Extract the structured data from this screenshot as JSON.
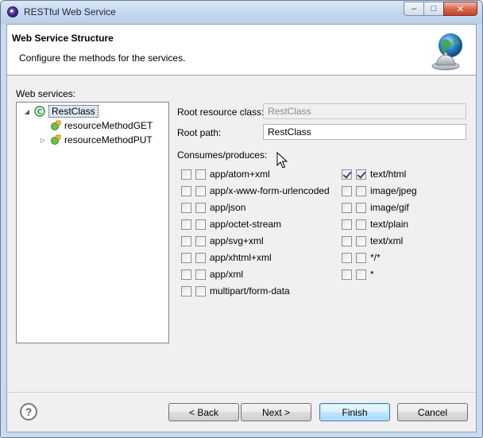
{
  "window": {
    "title": "RESTful Web Service",
    "minimize_glyph": "–",
    "maximize_glyph": "□",
    "close_glyph": "✕"
  },
  "banner": {
    "title": "Web Service Structure",
    "subtitle": "Configure the methods for the services.",
    "icon": "globe-bell-icon"
  },
  "web_services": {
    "label": "Web services:",
    "tree": [
      {
        "label": "RestClass",
        "level": 0,
        "expanded": true,
        "selected": true,
        "icon": "rest-class-icon"
      },
      {
        "label": "resourceMethodGET",
        "level": 1,
        "expanded": false,
        "has_children": false,
        "icon": "resource-method-icon"
      },
      {
        "label": "resourceMethodPUT",
        "level": 1,
        "expanded": false,
        "has_children": true,
        "icon": "resource-method-icon"
      }
    ]
  },
  "form": {
    "root_resource_class_label": "Root resource class:",
    "root_resource_class_value": "RestClass",
    "root_path_label": "Root path:",
    "root_path_value": "RestClass",
    "consumes_produces_label": "Consumes/produces:"
  },
  "media_types_left": [
    {
      "label": "app/atom+xml",
      "consumes": false,
      "produces": false
    },
    {
      "label": "app/x-www-form-urlencoded",
      "consumes": false,
      "produces": false
    },
    {
      "label": "app/json",
      "consumes": false,
      "produces": false
    },
    {
      "label": "app/octet-stream",
      "consumes": false,
      "produces": false
    },
    {
      "label": "app/svg+xml",
      "consumes": false,
      "produces": false
    },
    {
      "label": "app/xhtml+xml",
      "consumes": false,
      "produces": false
    },
    {
      "label": "app/xml",
      "consumes": false,
      "produces": false
    },
    {
      "label": "multipart/form-data",
      "consumes": false,
      "produces": false
    }
  ],
  "media_types_right": [
    {
      "label": "text/html",
      "consumes": true,
      "produces": true
    },
    {
      "label": "image/jpeg",
      "consumes": false,
      "produces": false
    },
    {
      "label": "image/gif",
      "consumes": false,
      "produces": false
    },
    {
      "label": "text/plain",
      "consumes": false,
      "produces": false
    },
    {
      "label": "text/xml",
      "consumes": false,
      "produces": false
    },
    {
      "label": "*/*",
      "consumes": false,
      "produces": false
    },
    {
      "label": "*",
      "consumes": false,
      "produces": false
    }
  ],
  "buttons": {
    "help": "?",
    "back": "< Back",
    "next": "Next >",
    "finish": "Finish",
    "cancel": "Cancel"
  }
}
